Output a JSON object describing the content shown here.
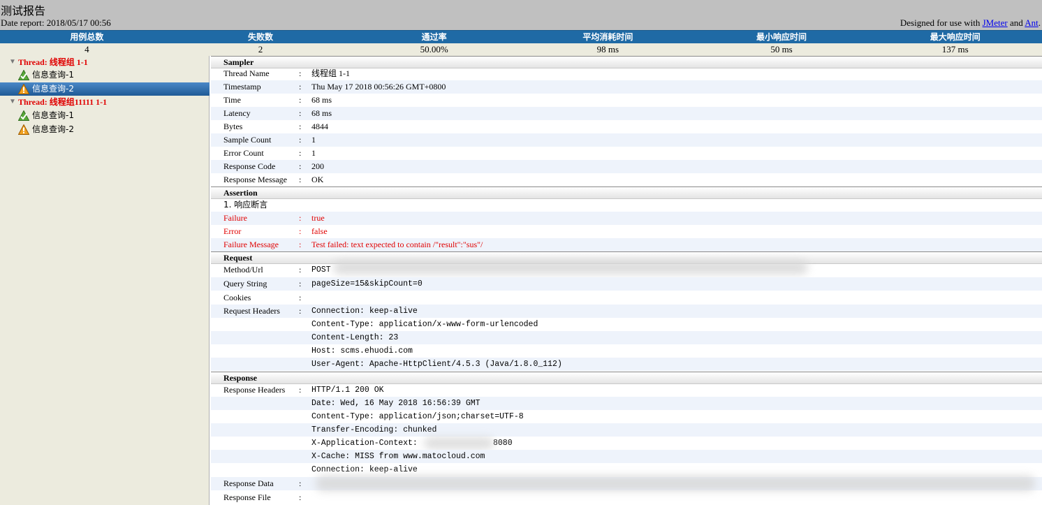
{
  "header": {
    "title": "测试报告",
    "date_report": "Date report: 2018/05/17 00:56",
    "designed_prefix": "Designed for use with ",
    "jmeter_link": "JMeter",
    "and_text": " and ",
    "ant_link": "Ant",
    "suffix": "."
  },
  "summary": {
    "headers": [
      "用例总数",
      "失败数",
      "通过率",
      "平均消耗时间",
      "最小响应时间",
      "最大响应时间"
    ],
    "values": [
      "4",
      "2",
      "50.00%",
      "98 ms",
      "50 ms",
      "137 ms"
    ]
  },
  "tree": {
    "threads": [
      {
        "label": "Thread: 线程组 1-1",
        "items": [
          {
            "label": "信息查询-1",
            "status": "pass",
            "icon": "success-icon"
          },
          {
            "label": "信息查询-2",
            "status": "fail",
            "icon": "warning-icon"
          }
        ]
      },
      {
        "label": "Thread: 线程组11111 1-1",
        "items": [
          {
            "label": "信息查询-1",
            "status": "pass",
            "icon": "success-icon"
          },
          {
            "label": "信息查询-2",
            "status": "fail",
            "icon": "warning-icon"
          }
        ]
      }
    ],
    "selected": "Thread 1 / 信息查询-2"
  },
  "details": {
    "sampler_title": "Sampler",
    "sampler": [
      {
        "key": "Thread Name",
        "value": "线程组 1-1"
      },
      {
        "key": "Timestamp",
        "value": "Thu May 17 2018 00:56:26 GMT+0800"
      },
      {
        "key": "Time",
        "value": "68 ms"
      },
      {
        "key": "Latency",
        "value": "68 ms"
      },
      {
        "key": "Bytes",
        "value": "4844"
      },
      {
        "key": "Sample Count",
        "value": "1"
      },
      {
        "key": "Error Count",
        "value": "1"
      },
      {
        "key": "Response Code",
        "value": "200"
      },
      {
        "key": "Response Message",
        "value": "OK"
      }
    ],
    "assertion_title": "Assertion",
    "assertion_name": "1. 响应断言",
    "assertion": [
      {
        "key": "Failure",
        "value": "true"
      },
      {
        "key": "Error",
        "value": "false"
      },
      {
        "key": "Failure Message",
        "value": "Test failed: text expected to contain /\"result\":\"sus\"/"
      }
    ],
    "request_title": "Request",
    "request": {
      "method_key": "Method/Url",
      "method_value": "POST",
      "query_key": "Query String",
      "query_value": "pageSize=15&skipCount=0",
      "cookies_key": "Cookies",
      "cookies_value": "",
      "headers_key": "Request Headers",
      "headers": [
        "Connection: keep-alive",
        "Content-Type: application/x-www-form-urlencoded",
        "Content-Length: 23",
        "Host: scms.ehuodi.com",
        "User-Agent: Apache-HttpClient/4.5.3 (Java/1.8.0_112)"
      ]
    },
    "response_title": "Response",
    "response": {
      "headers_key": "Response Headers",
      "headers": [
        "HTTP/1.1 200 OK",
        "Date: Wed, 16 May 2018 16:56:39 GMT",
        "Content-Type: application/json;charset=UTF-8",
        "Transfer-Encoding: chunked",
        "X-Application-Context:",
        "X-Cache: MISS from www.matocloud.com",
        "Connection: keep-alive"
      ],
      "app_context_port": "8080",
      "data_key": "Response Data",
      "file_key": "Response File"
    },
    "separator": ":"
  },
  "colors": {
    "header_bg": "#c0c0c0",
    "summary_head": "#1f6aa5",
    "summary_values_bg": "#ecebde",
    "thread_label": "#e00000",
    "selected_bg": "#316aa6",
    "alt_row": "#eef3fb"
  }
}
